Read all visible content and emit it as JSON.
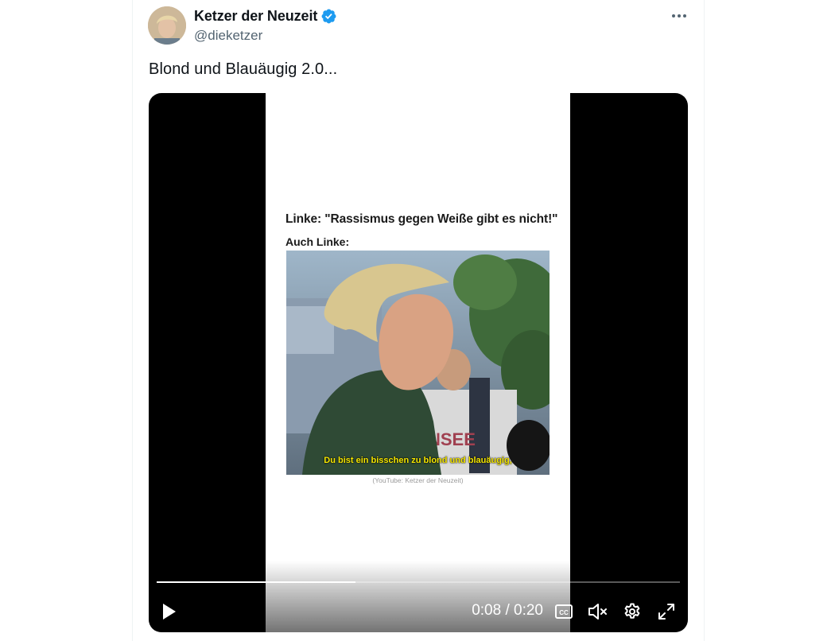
{
  "author": {
    "display_name": "Ketzer der Neuzeit",
    "handle": "@dieketzer",
    "verified": true
  },
  "tweet": {
    "text": "Blond und Blauäugig 2.0..."
  },
  "video": {
    "frame": {
      "headline": "Linke: \"Rassismus gegen Weiße gibt es nicht!\"",
      "subheadline": "Auch Linke:",
      "subtitle": "Du bist ein bisschen zu blond und blauäugig,",
      "credit": "(YouTube: Ketzer der Neuzeit)"
    },
    "time": "0:08 / 0:20",
    "progress": 0.38,
    "state": "paused",
    "muted": true
  },
  "icons": {
    "more": "more-horizontal-icon",
    "verified": "verified-badge-icon",
    "play": "play-icon",
    "cc": "closed-captions-icon",
    "mute": "volume-muted-icon",
    "settings": "gear-icon",
    "fullscreen": "fullscreen-icon"
  },
  "colors": {
    "verified_blue": "#1d9bf0",
    "text_primary": "#0f1419",
    "text_secondary": "#536471",
    "subtitle_yellow": "#f5e600"
  }
}
